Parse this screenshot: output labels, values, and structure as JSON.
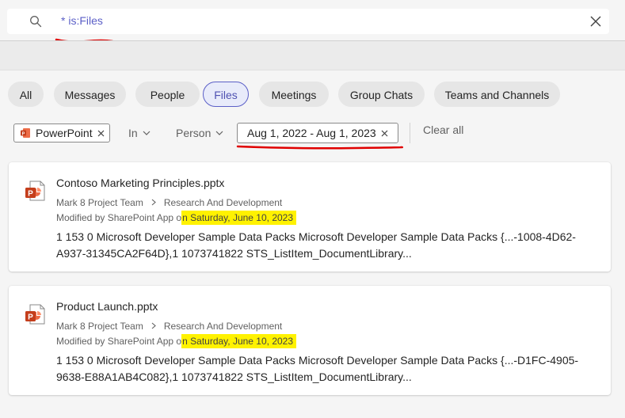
{
  "search": {
    "query": "* is:Files"
  },
  "tabs": [
    {
      "label": "All",
      "active": false
    },
    {
      "label": "Messages",
      "active": false
    },
    {
      "label": "People",
      "active": false
    },
    {
      "label": "Files",
      "active": true
    },
    {
      "label": "Meetings",
      "active": false
    },
    {
      "label": "Group Chats",
      "active": false
    },
    {
      "label": "Teams and Channels",
      "active": false
    }
  ],
  "filters": {
    "filetype_label": "PowerPoint",
    "in_label": "In",
    "person_label": "Person",
    "date_label": "Aug 1, 2022 - Aug 1, 2023",
    "clear_all_label": "Clear all"
  },
  "results": [
    {
      "title": "Contoso Marketing Principles.pptx",
      "team": "Mark 8 Project Team",
      "channel": "Research And Development",
      "modified_prefix": "Modified by SharePoint App o",
      "modified_hl_prefix": "n",
      "modified_date": "Saturday, June 10, 2023",
      "snippet": "1 153 0 Microsoft Developer Sample Data Packs Microsoft Developer Sample Data Packs {...-1008-4D62-A937-31345CA2F64D},1 1073741822 STS_ListItem_DocumentLibrary..."
    },
    {
      "title": "Product Launch.pptx",
      "team": "Mark 8 Project Team",
      "channel": "Research And Development",
      "modified_prefix": "Modified by SharePoint App o",
      "modified_hl_prefix": "n",
      "modified_date": "Saturday, June 10, 2023",
      "snippet": "1 153 0 Microsoft Developer Sample Data Packs Microsoft Developer Sample Data Packs {...-D1FC-4905-9638-E88A1AB4C082},1 1073741822 STS_ListItem_DocumentLibrary..."
    }
  ],
  "colors": {
    "accent": "#5b5fc7",
    "highlight": "#fff200",
    "annotation": "#e00000",
    "powerpoint": "#c43e1c"
  },
  "icons": {
    "search": "search-icon",
    "close": "close-icon",
    "filetype": "powerpoint-icon",
    "chevron": "chevron-down-icon",
    "breadcrumb": "chevron-right-icon"
  }
}
